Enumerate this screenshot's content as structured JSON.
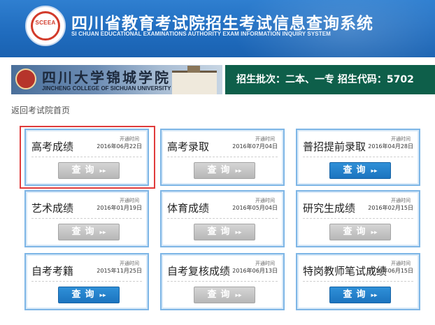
{
  "header": {
    "logo_text": "SCEEA",
    "title": "四川省教育考试院招生考试信息查询系统",
    "subtitle": "SI CHUAN EDUCATIONAL EXAMINATIONS AUTHORITY EXAM INFORMATION INQUIRY SYSTEM"
  },
  "banner": {
    "college_name_cn": "四川大学锦城学院",
    "college_name_en": "JINCHENG COLLEGE OF SICHUAN UNIVERSITY",
    "info": "招生批次：二本、一专  招生代码：5702"
  },
  "back_link": "返回考试院首页",
  "time_label": "开通时间",
  "query_label": "查询",
  "arrow": "▸▸",
  "cards": [
    {
      "title": "高考成绩",
      "date": "2016年06月22日",
      "button_style": "gray"
    },
    {
      "title": "高考录取",
      "date": "2016年07月04日",
      "button_style": "gray"
    },
    {
      "title": "普招提前录取",
      "date": "2016年04月28日",
      "button_style": "blue"
    },
    {
      "title": "艺术成绩",
      "date": "2016年01月19日",
      "button_style": "gray"
    },
    {
      "title": "体育成绩",
      "date": "2016年05月04日",
      "button_style": "gray"
    },
    {
      "title": "研究生成绩",
      "date": "2016年02月15日",
      "button_style": "gray"
    },
    {
      "title": "自考考籍",
      "date": "2015年11月25日",
      "button_style": "blue"
    },
    {
      "title": "自考复核成绩",
      "date": "2016年06月13日",
      "button_style": "gray"
    },
    {
      "title": "特岗教师笔试成绩",
      "date": "2016年06月15日",
      "button_style": "blue"
    }
  ],
  "colors": {
    "header_blue": "#1f6bbd",
    "banner_green": "#0e5f4a",
    "button_blue": "#1c74bf",
    "highlight_red": "#e03b3b"
  }
}
